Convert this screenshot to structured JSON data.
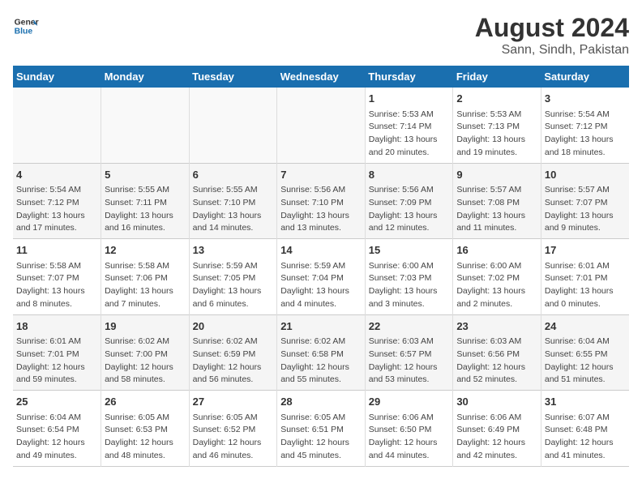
{
  "header": {
    "logo_line1": "General",
    "logo_line2": "Blue",
    "title": "August 2024",
    "subtitle": "Sann, Sindh, Pakistan"
  },
  "days_of_week": [
    "Sunday",
    "Monday",
    "Tuesday",
    "Wednesday",
    "Thursday",
    "Friday",
    "Saturday"
  ],
  "weeks": [
    [
      {
        "num": "",
        "info": ""
      },
      {
        "num": "",
        "info": ""
      },
      {
        "num": "",
        "info": ""
      },
      {
        "num": "",
        "info": ""
      },
      {
        "num": "1",
        "info": "Sunrise: 5:53 AM\nSunset: 7:14 PM\nDaylight: 13 hours\nand 20 minutes."
      },
      {
        "num": "2",
        "info": "Sunrise: 5:53 AM\nSunset: 7:13 PM\nDaylight: 13 hours\nand 19 minutes."
      },
      {
        "num": "3",
        "info": "Sunrise: 5:54 AM\nSunset: 7:12 PM\nDaylight: 13 hours\nand 18 minutes."
      }
    ],
    [
      {
        "num": "4",
        "info": "Sunrise: 5:54 AM\nSunset: 7:12 PM\nDaylight: 13 hours\nand 17 minutes."
      },
      {
        "num": "5",
        "info": "Sunrise: 5:55 AM\nSunset: 7:11 PM\nDaylight: 13 hours\nand 16 minutes."
      },
      {
        "num": "6",
        "info": "Sunrise: 5:55 AM\nSunset: 7:10 PM\nDaylight: 13 hours\nand 14 minutes."
      },
      {
        "num": "7",
        "info": "Sunrise: 5:56 AM\nSunset: 7:10 PM\nDaylight: 13 hours\nand 13 minutes."
      },
      {
        "num": "8",
        "info": "Sunrise: 5:56 AM\nSunset: 7:09 PM\nDaylight: 13 hours\nand 12 minutes."
      },
      {
        "num": "9",
        "info": "Sunrise: 5:57 AM\nSunset: 7:08 PM\nDaylight: 13 hours\nand 11 minutes."
      },
      {
        "num": "10",
        "info": "Sunrise: 5:57 AM\nSunset: 7:07 PM\nDaylight: 13 hours\nand 9 minutes."
      }
    ],
    [
      {
        "num": "11",
        "info": "Sunrise: 5:58 AM\nSunset: 7:07 PM\nDaylight: 13 hours\nand 8 minutes."
      },
      {
        "num": "12",
        "info": "Sunrise: 5:58 AM\nSunset: 7:06 PM\nDaylight: 13 hours\nand 7 minutes."
      },
      {
        "num": "13",
        "info": "Sunrise: 5:59 AM\nSunset: 7:05 PM\nDaylight: 13 hours\nand 6 minutes."
      },
      {
        "num": "14",
        "info": "Sunrise: 5:59 AM\nSunset: 7:04 PM\nDaylight: 13 hours\nand 4 minutes."
      },
      {
        "num": "15",
        "info": "Sunrise: 6:00 AM\nSunset: 7:03 PM\nDaylight: 13 hours\nand 3 minutes."
      },
      {
        "num": "16",
        "info": "Sunrise: 6:00 AM\nSunset: 7:02 PM\nDaylight: 13 hours\nand 2 minutes."
      },
      {
        "num": "17",
        "info": "Sunrise: 6:01 AM\nSunset: 7:01 PM\nDaylight: 13 hours\nand 0 minutes."
      }
    ],
    [
      {
        "num": "18",
        "info": "Sunrise: 6:01 AM\nSunset: 7:01 PM\nDaylight: 12 hours\nand 59 minutes."
      },
      {
        "num": "19",
        "info": "Sunrise: 6:02 AM\nSunset: 7:00 PM\nDaylight: 12 hours\nand 58 minutes."
      },
      {
        "num": "20",
        "info": "Sunrise: 6:02 AM\nSunset: 6:59 PM\nDaylight: 12 hours\nand 56 minutes."
      },
      {
        "num": "21",
        "info": "Sunrise: 6:02 AM\nSunset: 6:58 PM\nDaylight: 12 hours\nand 55 minutes."
      },
      {
        "num": "22",
        "info": "Sunrise: 6:03 AM\nSunset: 6:57 PM\nDaylight: 12 hours\nand 53 minutes."
      },
      {
        "num": "23",
        "info": "Sunrise: 6:03 AM\nSunset: 6:56 PM\nDaylight: 12 hours\nand 52 minutes."
      },
      {
        "num": "24",
        "info": "Sunrise: 6:04 AM\nSunset: 6:55 PM\nDaylight: 12 hours\nand 51 minutes."
      }
    ],
    [
      {
        "num": "25",
        "info": "Sunrise: 6:04 AM\nSunset: 6:54 PM\nDaylight: 12 hours\nand 49 minutes."
      },
      {
        "num": "26",
        "info": "Sunrise: 6:05 AM\nSunset: 6:53 PM\nDaylight: 12 hours\nand 48 minutes."
      },
      {
        "num": "27",
        "info": "Sunrise: 6:05 AM\nSunset: 6:52 PM\nDaylight: 12 hours\nand 46 minutes."
      },
      {
        "num": "28",
        "info": "Sunrise: 6:05 AM\nSunset: 6:51 PM\nDaylight: 12 hours\nand 45 minutes."
      },
      {
        "num": "29",
        "info": "Sunrise: 6:06 AM\nSunset: 6:50 PM\nDaylight: 12 hours\nand 44 minutes."
      },
      {
        "num": "30",
        "info": "Sunrise: 6:06 AM\nSunset: 6:49 PM\nDaylight: 12 hours\nand 42 minutes."
      },
      {
        "num": "31",
        "info": "Sunrise: 6:07 AM\nSunset: 6:48 PM\nDaylight: 12 hours\nand 41 minutes."
      }
    ]
  ]
}
